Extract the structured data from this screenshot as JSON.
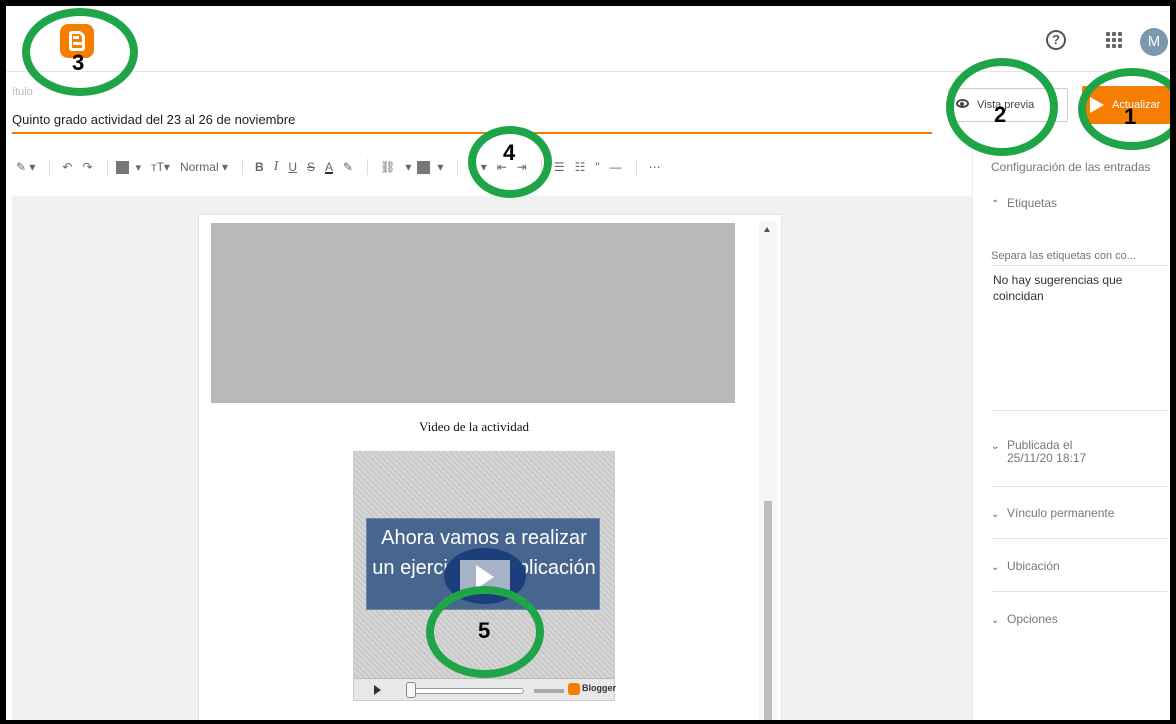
{
  "header": {
    "logo": "blogger-logo-icon",
    "help_icon": "?",
    "apps_icon": "apps-grid-icon",
    "avatar_initial": "M"
  },
  "post": {
    "title_label": "ítulo",
    "title_value": "Quinto grado actividad del 23 al 26 de noviembre"
  },
  "actions": {
    "preview_label": "Vista previa",
    "update_label": "Actualizar"
  },
  "toolbar": {
    "items": [
      "✎ ▾",
      "↶",
      "↷",
      "▾",
      "тT▾",
      "Normal ▾",
      "B",
      "I",
      "U",
      "S",
      "A",
      "✎",
      "⛓",
      "▾",
      "▾",
      "≡ ▾",
      "⇤",
      "⇥",
      "☰",
      "☷",
      "\"",
      "—",
      "⋯"
    ],
    "format_label": "Normal"
  },
  "sidebar": {
    "title": "Configuración de las entradas",
    "tags_label": "Etiquetas",
    "tags_placeholder": "Separa las etiquetas con co...",
    "no_suggestions": "No hay sugerencias que coincidan",
    "published_label": "Publicada el",
    "published_date": "25/11/20 18:17",
    "permalink_label": "Vínculo permanente",
    "location_label": "Ubicación",
    "options_label": "Opciones"
  },
  "document": {
    "caption": "Video de la actividad",
    "video_text": "Ahora vamos a realizar un ejercicio de aplicación",
    "video_brand": "Blogger"
  },
  "annotations": [
    "1",
    "2",
    "3",
    "4",
    "5"
  ],
  "colors": {
    "accent": "#f57d00",
    "annotation": "#1fa447"
  }
}
